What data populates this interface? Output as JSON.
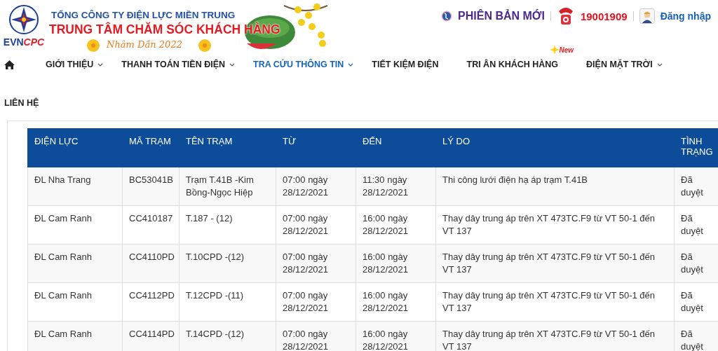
{
  "header": {
    "logo_text": "EVNCPC",
    "company": "TỔNG CÔNG TY ĐIỆN LỰC MIỀN TRUNG",
    "center": "TRUNG TÂM CHĂM SÓC KHÁCH HÀNG",
    "greeting": "Nhâm Dần 2022",
    "new_version": "PHIÊN BẢN MỚI",
    "hotline": "19001909",
    "login": "Đăng nhập"
  },
  "nav": [
    {
      "label": "GIỚI THIỆU",
      "selected": false,
      "dropdown": true
    },
    {
      "label": "THANH TOÁN TIỀN ĐIỆN",
      "selected": false,
      "dropdown": true
    },
    {
      "label": "TRA CỨU THÔNG TIN",
      "selected": true,
      "dropdown": true
    },
    {
      "label": "TIẾT KIỆM ĐIỆN",
      "selected": false,
      "dropdown": false
    },
    {
      "label": "TRI ÂN KHÁCH HÀNG",
      "selected": false,
      "dropdown": false,
      "badge": "New"
    },
    {
      "label": "ĐIỆN MẶT TRỜI",
      "selected": false,
      "dropdown": true
    },
    {
      "label": "LIÊN HỆ",
      "selected": false,
      "dropdown": false
    }
  ],
  "table": {
    "columns": [
      "ĐIỆN LỰC",
      "MÃ TRẠM",
      "TÊN TRẠM",
      "TỪ",
      "ĐẾN",
      "LÝ DO",
      "TÌNH TRẠNG"
    ],
    "rows": [
      [
        "ĐL Nha Trang",
        "BC53041B",
        "Trạm T.41B -Kim Bồng-Ngọc Hiệp",
        "07:00 ngày 28/12/2021",
        "11:30 ngày 28/12/2021",
        "Thi công lưới điện hạ áp trạm T.41B",
        "Đã duyệt"
      ],
      [
        "ĐL Cam Ranh",
        "CC410187",
        "T.187 - (12)",
        "07:00 ngày 28/12/2021",
        "16:00 ngày 28/12/2021",
        "Thay dây trung áp trên XT 473TC.F9 từ VT 50-1 đến VT 137",
        "Đã duyệt"
      ],
      [
        "ĐL Cam Ranh",
        "CC4110PD",
        "T.10CPD -(12)",
        "07:00 ngày 28/12/2021",
        "16:00 ngày 28/12/2021",
        "Thay dây trung áp trên XT 473TC.F9 từ VT 50-1 đến VT 137",
        "Đã duyệt"
      ],
      [
        "ĐL Cam Ranh",
        "CC4112PD",
        "T.12CPD -(11)",
        "07:00 ngày 28/12/2021",
        "16:00 ngày 28/12/2021",
        "Thay dây trung áp trên XT 473TC.F9 từ VT 50-1 đến VT 137",
        "Đã duyệt"
      ],
      [
        "ĐL Cam Ranh",
        "CC4114PD",
        "T.14CPD -(12)",
        "07:00 ngày 28/12/2021",
        "16:00 ngày 28/12/2021",
        "Thay dây trung áp trên XT 473TC.F9 từ VT 50-1 đến VT 137",
        "Đã duyệt"
      ]
    ]
  }
}
